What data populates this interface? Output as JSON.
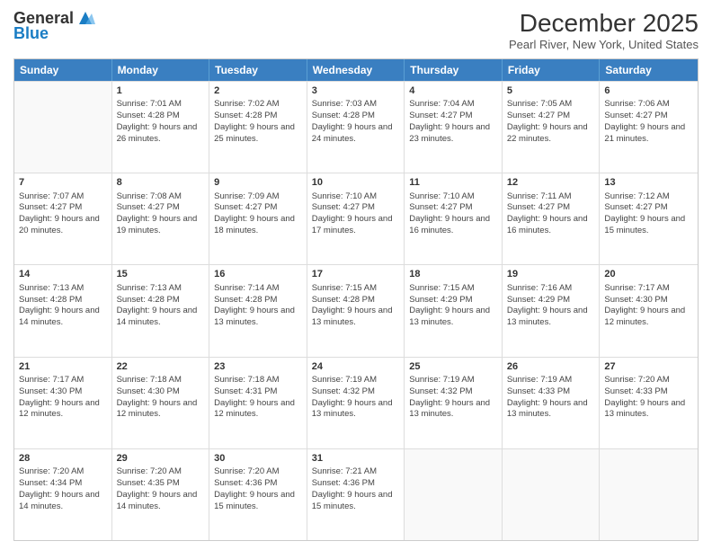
{
  "header": {
    "logo_general": "General",
    "logo_blue": "Blue",
    "month": "December 2025",
    "location": "Pearl River, New York, United States"
  },
  "days_of_week": [
    "Sunday",
    "Monday",
    "Tuesday",
    "Wednesday",
    "Thursday",
    "Friday",
    "Saturday"
  ],
  "weeks": [
    [
      {
        "day": "",
        "sunrise": "",
        "sunset": "",
        "daylight": ""
      },
      {
        "day": "1",
        "sunrise": "Sunrise: 7:01 AM",
        "sunset": "Sunset: 4:28 PM",
        "daylight": "Daylight: 9 hours and 26 minutes."
      },
      {
        "day": "2",
        "sunrise": "Sunrise: 7:02 AM",
        "sunset": "Sunset: 4:28 PM",
        "daylight": "Daylight: 9 hours and 25 minutes."
      },
      {
        "day": "3",
        "sunrise": "Sunrise: 7:03 AM",
        "sunset": "Sunset: 4:28 PM",
        "daylight": "Daylight: 9 hours and 24 minutes."
      },
      {
        "day": "4",
        "sunrise": "Sunrise: 7:04 AM",
        "sunset": "Sunset: 4:27 PM",
        "daylight": "Daylight: 9 hours and 23 minutes."
      },
      {
        "day": "5",
        "sunrise": "Sunrise: 7:05 AM",
        "sunset": "Sunset: 4:27 PM",
        "daylight": "Daylight: 9 hours and 22 minutes."
      },
      {
        "day": "6",
        "sunrise": "Sunrise: 7:06 AM",
        "sunset": "Sunset: 4:27 PM",
        "daylight": "Daylight: 9 hours and 21 minutes."
      }
    ],
    [
      {
        "day": "7",
        "sunrise": "Sunrise: 7:07 AM",
        "sunset": "Sunset: 4:27 PM",
        "daylight": "Daylight: 9 hours and 20 minutes."
      },
      {
        "day": "8",
        "sunrise": "Sunrise: 7:08 AM",
        "sunset": "Sunset: 4:27 PM",
        "daylight": "Daylight: 9 hours and 19 minutes."
      },
      {
        "day": "9",
        "sunrise": "Sunrise: 7:09 AM",
        "sunset": "Sunset: 4:27 PM",
        "daylight": "Daylight: 9 hours and 18 minutes."
      },
      {
        "day": "10",
        "sunrise": "Sunrise: 7:10 AM",
        "sunset": "Sunset: 4:27 PM",
        "daylight": "Daylight: 9 hours and 17 minutes."
      },
      {
        "day": "11",
        "sunrise": "Sunrise: 7:10 AM",
        "sunset": "Sunset: 4:27 PM",
        "daylight": "Daylight: 9 hours and 16 minutes."
      },
      {
        "day": "12",
        "sunrise": "Sunrise: 7:11 AM",
        "sunset": "Sunset: 4:27 PM",
        "daylight": "Daylight: 9 hours and 16 minutes."
      },
      {
        "day": "13",
        "sunrise": "Sunrise: 7:12 AM",
        "sunset": "Sunset: 4:27 PM",
        "daylight": "Daylight: 9 hours and 15 minutes."
      }
    ],
    [
      {
        "day": "14",
        "sunrise": "Sunrise: 7:13 AM",
        "sunset": "Sunset: 4:28 PM",
        "daylight": "Daylight: 9 hours and 14 minutes."
      },
      {
        "day": "15",
        "sunrise": "Sunrise: 7:13 AM",
        "sunset": "Sunset: 4:28 PM",
        "daylight": "Daylight: 9 hours and 14 minutes."
      },
      {
        "day": "16",
        "sunrise": "Sunrise: 7:14 AM",
        "sunset": "Sunset: 4:28 PM",
        "daylight": "Daylight: 9 hours and 13 minutes."
      },
      {
        "day": "17",
        "sunrise": "Sunrise: 7:15 AM",
        "sunset": "Sunset: 4:28 PM",
        "daylight": "Daylight: 9 hours and 13 minutes."
      },
      {
        "day": "18",
        "sunrise": "Sunrise: 7:15 AM",
        "sunset": "Sunset: 4:29 PM",
        "daylight": "Daylight: 9 hours and 13 minutes."
      },
      {
        "day": "19",
        "sunrise": "Sunrise: 7:16 AM",
        "sunset": "Sunset: 4:29 PM",
        "daylight": "Daylight: 9 hours and 13 minutes."
      },
      {
        "day": "20",
        "sunrise": "Sunrise: 7:17 AM",
        "sunset": "Sunset: 4:30 PM",
        "daylight": "Daylight: 9 hours and 12 minutes."
      }
    ],
    [
      {
        "day": "21",
        "sunrise": "Sunrise: 7:17 AM",
        "sunset": "Sunset: 4:30 PM",
        "daylight": "Daylight: 9 hours and 12 minutes."
      },
      {
        "day": "22",
        "sunrise": "Sunrise: 7:18 AM",
        "sunset": "Sunset: 4:30 PM",
        "daylight": "Daylight: 9 hours and 12 minutes."
      },
      {
        "day": "23",
        "sunrise": "Sunrise: 7:18 AM",
        "sunset": "Sunset: 4:31 PM",
        "daylight": "Daylight: 9 hours and 12 minutes."
      },
      {
        "day": "24",
        "sunrise": "Sunrise: 7:19 AM",
        "sunset": "Sunset: 4:32 PM",
        "daylight": "Daylight: 9 hours and 13 minutes."
      },
      {
        "day": "25",
        "sunrise": "Sunrise: 7:19 AM",
        "sunset": "Sunset: 4:32 PM",
        "daylight": "Daylight: 9 hours and 13 minutes."
      },
      {
        "day": "26",
        "sunrise": "Sunrise: 7:19 AM",
        "sunset": "Sunset: 4:33 PM",
        "daylight": "Daylight: 9 hours and 13 minutes."
      },
      {
        "day": "27",
        "sunrise": "Sunrise: 7:20 AM",
        "sunset": "Sunset: 4:33 PM",
        "daylight": "Daylight: 9 hours and 13 minutes."
      }
    ],
    [
      {
        "day": "28",
        "sunrise": "Sunrise: 7:20 AM",
        "sunset": "Sunset: 4:34 PM",
        "daylight": "Daylight: 9 hours and 14 minutes."
      },
      {
        "day": "29",
        "sunrise": "Sunrise: 7:20 AM",
        "sunset": "Sunset: 4:35 PM",
        "daylight": "Daylight: 9 hours and 14 minutes."
      },
      {
        "day": "30",
        "sunrise": "Sunrise: 7:20 AM",
        "sunset": "Sunset: 4:36 PM",
        "daylight": "Daylight: 9 hours and 15 minutes."
      },
      {
        "day": "31",
        "sunrise": "Sunrise: 7:21 AM",
        "sunset": "Sunset: 4:36 PM",
        "daylight": "Daylight: 9 hours and 15 minutes."
      },
      {
        "day": "",
        "sunrise": "",
        "sunset": "",
        "daylight": ""
      },
      {
        "day": "",
        "sunrise": "",
        "sunset": "",
        "daylight": ""
      },
      {
        "day": "",
        "sunrise": "",
        "sunset": "",
        "daylight": ""
      }
    ]
  ]
}
